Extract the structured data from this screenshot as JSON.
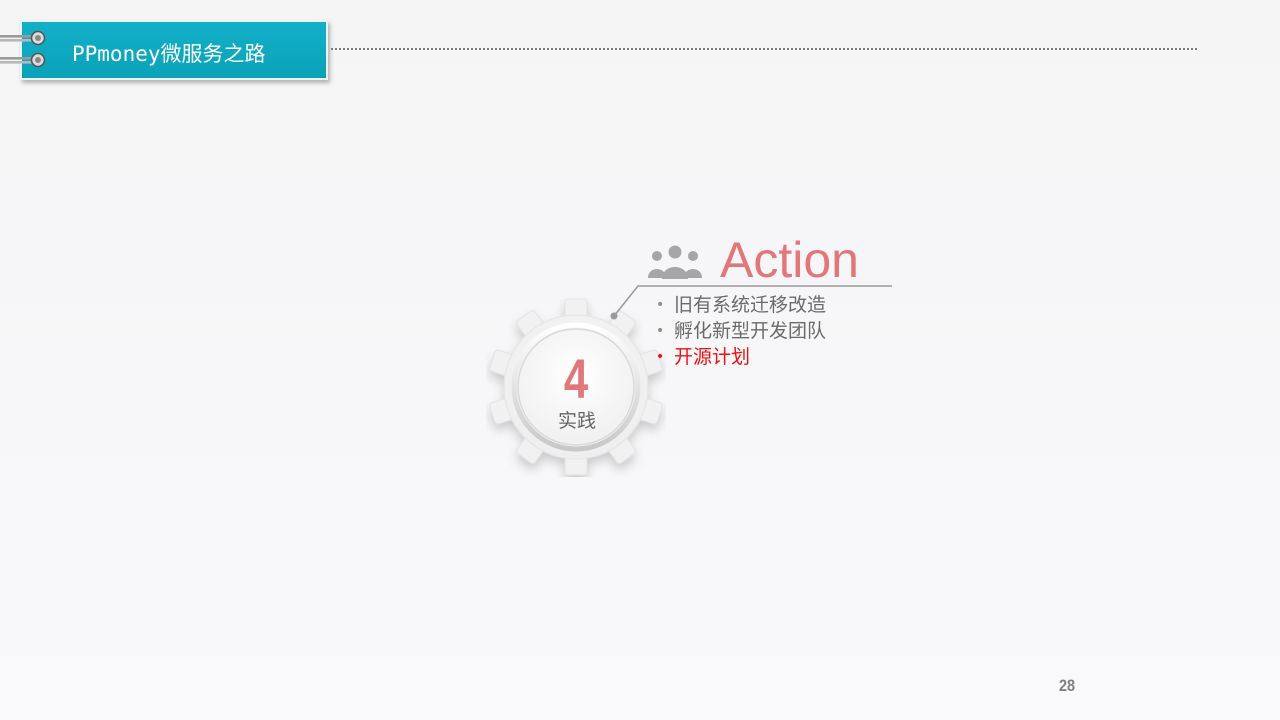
{
  "header": {
    "title": "PPmoney微服务之路"
  },
  "section": {
    "number": "4",
    "label": "实践",
    "icon": "people-group-icon"
  },
  "callout": {
    "title": "Action",
    "items": [
      {
        "text": "旧有系统迁移改造",
        "active": false
      },
      {
        "text": "孵化新型开发团队",
        "active": false
      },
      {
        "text": "开源计划",
        "active": true
      }
    ]
  },
  "footer": {
    "page_number": "28"
  },
  "colors": {
    "accent": "#0fa9bf",
    "highlight": "#e27779",
    "active_item": "#ee1111",
    "text_gray": "#6b6b6b"
  }
}
